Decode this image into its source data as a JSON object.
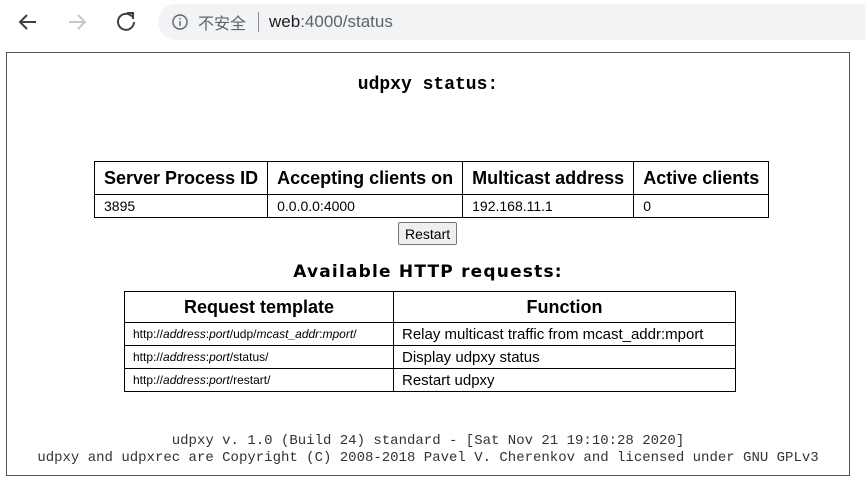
{
  "browser": {
    "back_icon": "arrow-left-icon",
    "forward_icon": "arrow-right-icon",
    "reload_icon": "reload-icon",
    "info_icon": "info-icon",
    "security_label": "不安全",
    "url_host": "web",
    "url_rest": ":4000/status"
  },
  "page": {
    "title": "udpxy status:",
    "status_table": {
      "headers": [
        "Server Process ID",
        "Accepting clients on",
        "Multicast address",
        "Active clients"
      ],
      "row": [
        "3895",
        "0.0.0.0:4000",
        "192.168.11.1",
        "0"
      ]
    },
    "restart_label": "Restart",
    "requests_title": "Available HTTP requests:",
    "requests_table": {
      "headers": [
        "Request template",
        "Function"
      ],
      "rows": [
        {
          "tpl_prefix": "http://",
          "tpl_italic1": "address",
          "tpl_colon": ":",
          "tpl_italic2": "port",
          "tpl_mid": "/udp/",
          "tpl_italic3": "mcast_addr",
          "tpl_colon2": ":",
          "tpl_italic4": "mport",
          "tpl_suffix": "/",
          "function": "Relay multicast traffic from mcast_addr:mport"
        },
        {
          "tpl_prefix": "http://",
          "tpl_italic1": "address",
          "tpl_colon": ":",
          "tpl_italic2": "port",
          "tpl_mid": "/status/",
          "function": "Display udpxy status"
        },
        {
          "tpl_prefix": "http://",
          "tpl_italic1": "address",
          "tpl_colon": ":",
          "tpl_italic2": "port",
          "tpl_mid": "/restart/",
          "function": "Restart udpxy"
        }
      ]
    },
    "footer_line1": "udpxy v. 1.0 (Build 24) standard - [Sat Nov 21 19:10:28 2020]",
    "footer_line2": "udpxy and udpxrec are Copyright (C) 2008-2018 Pavel V. Cherenkov and licensed under GNU GPLv3"
  }
}
